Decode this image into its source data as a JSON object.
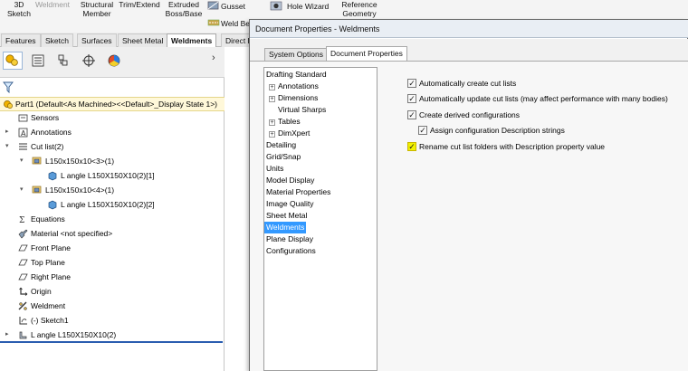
{
  "ribbon": {
    "sketch3d": "3D\nSketch",
    "weldment": "Weldment",
    "structural_member": "Structural\nMember",
    "trim_extend": "Trim/Extend",
    "extruded_boss": "Extruded\nBoss/Base",
    "gusset": "Gusset",
    "weld_bead": "Weld Be",
    "hole_wizard": "Hole Wizard",
    "reference_geometry": "Reference\nGeometry"
  },
  "command_tabs": [
    "Features",
    "Sketch",
    "Surfaces",
    "Sheet Metal",
    "Weldments",
    "Direct E"
  ],
  "command_tabs_active": "Weldments",
  "feature_tree": {
    "root": "Part1  (Default<As Machined><<Default>_Display State 1>)",
    "items": [
      {
        "label": "Sensors",
        "icon": "sensors-icon"
      },
      {
        "label": "Annotations",
        "icon": "annotations-icon"
      },
      {
        "label": "Cut list(2)",
        "icon": "cut-list-icon"
      },
      {
        "label": "L150x150x10<3>(1)",
        "icon": "cut-list-folder-icon"
      },
      {
        "label": "L angle L150X150X10(2)[1]",
        "icon": "solid-body-icon"
      },
      {
        "label": "L150x150x10<4>(1)",
        "icon": "cut-list-folder-icon"
      },
      {
        "label": "L angle L150X150X10(2)[2]",
        "icon": "solid-body-icon"
      },
      {
        "label": "Equations",
        "icon": "equations-icon"
      },
      {
        "label": "Material <not specified>",
        "icon": "material-icon"
      },
      {
        "label": "Front Plane",
        "icon": "plane-icon"
      },
      {
        "label": "Top Plane",
        "icon": "plane-icon"
      },
      {
        "label": "Right Plane",
        "icon": "plane-icon"
      },
      {
        "label": "Origin",
        "icon": "origin-icon"
      },
      {
        "label": "Weldment",
        "icon": "weldment-icon"
      },
      {
        "label": "(-) Sketch1",
        "icon": "sketch-icon"
      },
      {
        "label": "L angle L150X150X10(2)",
        "icon": "structural-member-icon"
      }
    ]
  },
  "dialog": {
    "title": "Document Properties - Weldments",
    "tabs": [
      "System Options",
      "Document Properties"
    ],
    "active_tab": "Document Properties",
    "categories": [
      "Drafting Standard",
      "Annotations",
      "Dimensions",
      "Virtual Sharps",
      "Tables",
      "DimXpert",
      "Detailing",
      "Grid/Snap",
      "Units",
      "Model Display",
      "Material Properties",
      "Image Quality",
      "Sheet Metal",
      "Weldments",
      "Plane Display",
      "Configurations"
    ],
    "selected_category": "Weldments",
    "options": [
      {
        "label": "Automatically create cut lists",
        "checked": true
      },
      {
        "label": "Automatically update cut lists (may affect performance with many bodies)",
        "checked": true
      },
      {
        "label": "Create derived configurations",
        "checked": true
      },
      {
        "label": "Assign configuration Description strings",
        "checked": true
      },
      {
        "label": "Rename cut list folders with Description property value",
        "checked": true,
        "highlight_color": "#f2f200"
      }
    ]
  },
  "colors": {
    "selection": "#3399ff",
    "highlight": "#f2f200",
    "root_background": "#fff8d9",
    "accent_line": "#2a5db0"
  }
}
